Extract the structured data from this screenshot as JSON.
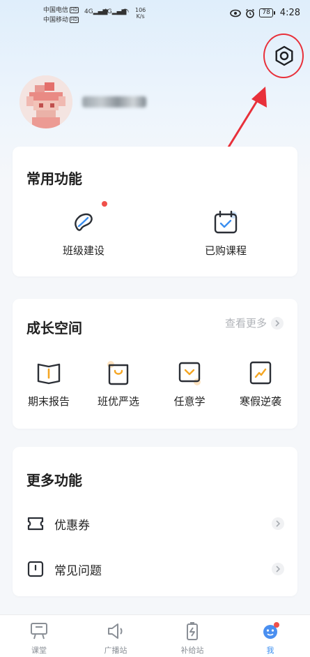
{
  "status_bar": {
    "carrier1": "中国电信",
    "carrier2": "中国移动",
    "hd": "HD",
    "signal1": "4G",
    "signal2": "4G",
    "net_speed_value": "106",
    "net_speed_unit": "K/s",
    "battery": "78",
    "time": "4:28"
  },
  "profile": {
    "username": "█████"
  },
  "common_functions": {
    "title": "常用功能",
    "items": [
      {
        "label": "班级建设",
        "icon": "bean-icon",
        "has_badge": true
      },
      {
        "label": "已购课程",
        "icon": "calendar-check-icon",
        "has_badge": false
      }
    ]
  },
  "growth_space": {
    "title": "成长空间",
    "see_more": "查看更多",
    "items": [
      {
        "label": "期末报告",
        "icon": "book-icon"
      },
      {
        "label": "班优严选",
        "icon": "shopping-bag-icon"
      },
      {
        "label": "任意学",
        "icon": "chevron-box-icon"
      },
      {
        "label": "寒假逆袭",
        "icon": "trend-icon"
      }
    ]
  },
  "more_functions": {
    "title": "更多功能",
    "items": [
      {
        "label": "优惠券",
        "icon": "coupon-icon"
      },
      {
        "label": "常见问题",
        "icon": "faq-icon"
      }
    ]
  },
  "bottom_nav": {
    "items": [
      {
        "label": "课堂",
        "icon": "classroom-icon",
        "active": false
      },
      {
        "label": "广播站",
        "icon": "broadcast-icon",
        "active": false
      },
      {
        "label": "补给站",
        "icon": "supply-icon",
        "active": false
      },
      {
        "label": "我",
        "icon": "me-icon",
        "active": true
      }
    ]
  },
  "colors": {
    "accent_orange": "#f5a623",
    "icon_dark": "#2b2f36",
    "blue_check": "#3a8ef0",
    "annotation_red": "#e8303a",
    "badge_red": "#f0504a"
  }
}
